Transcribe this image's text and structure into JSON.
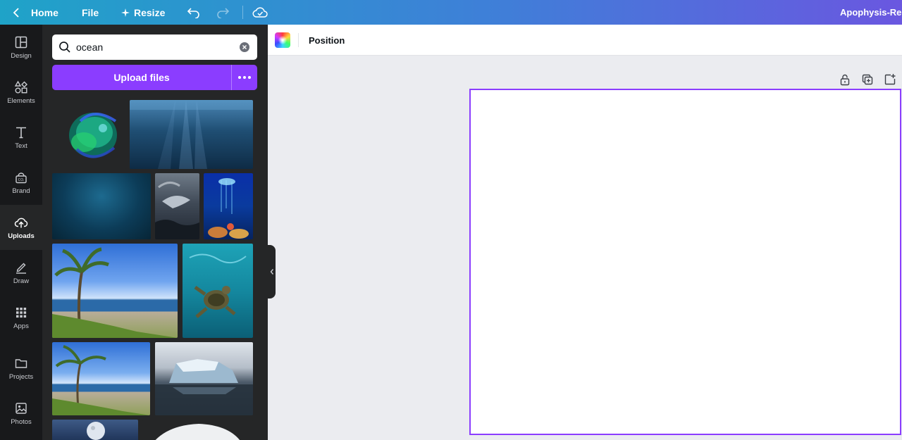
{
  "topbar": {
    "home_label": "Home",
    "file_label": "File",
    "resize_label": "Resize",
    "title": "Apophysis-Rec",
    "icons": [
      "chevron-left-icon",
      "resize-icon",
      "undo-icon",
      "redo-icon",
      "cloud-saved-icon"
    ]
  },
  "rail": {
    "items": [
      {
        "label": "Design",
        "icon": "layout-icon"
      },
      {
        "label": "Elements",
        "icon": "shapes-icon"
      },
      {
        "label": "Text",
        "icon": "text-icon"
      },
      {
        "label": "Brand",
        "icon": "brand-icon"
      },
      {
        "label": "Uploads",
        "icon": "cloud-upload-icon",
        "active": true
      },
      {
        "label": "Draw",
        "icon": "pen-icon"
      },
      {
        "label": "Apps",
        "icon": "apps-grid-icon"
      },
      {
        "label": "Projects",
        "icon": "folder-icon"
      },
      {
        "label": "Photos",
        "icon": "image-icon"
      }
    ]
  },
  "panel": {
    "search": {
      "value": "ocean"
    },
    "upload_label": "Upload files"
  },
  "context_toolbar": {
    "position_label": "Position"
  },
  "colors": {
    "accent": "#8b3dff",
    "rail_bg": "#18191b",
    "panel_bg": "#252627",
    "canvas_bg": "#ebecf0"
  }
}
